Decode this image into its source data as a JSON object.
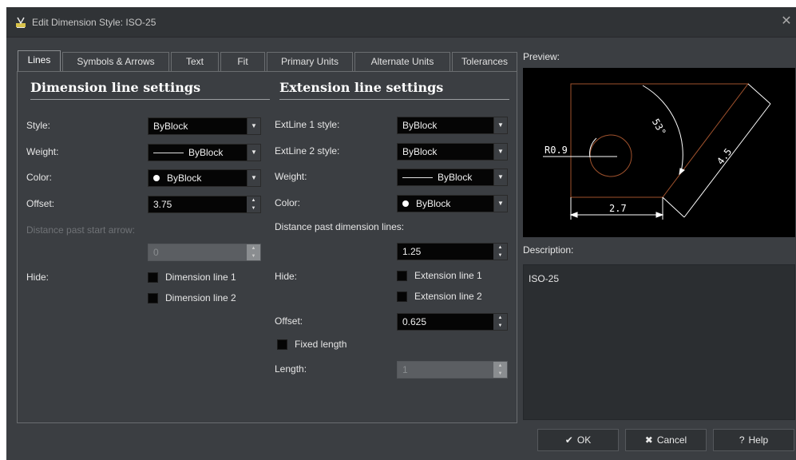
{
  "window": {
    "title": "Edit Dimension Style: ISO-25",
    "close_glyph": "✕",
    "icon": "dimension-style-icon"
  },
  "tabs": [
    {
      "label": "Lines",
      "active": true
    },
    {
      "label": "Symbols & Arrows"
    },
    {
      "label": "Text"
    },
    {
      "label": "Fit"
    },
    {
      "label": "Primary Units"
    },
    {
      "label": "Alternate Units"
    },
    {
      "label": "Tolerances"
    }
  ],
  "dimension_line": {
    "heading": "Dimension line settings",
    "style": {
      "label": "Style:",
      "value": "ByBlock"
    },
    "weight": {
      "label": "Weight:",
      "value": "ByBlock"
    },
    "color": {
      "label": "Color:",
      "value": "ByBlock"
    },
    "offset": {
      "label": "Offset:",
      "value": "3.75"
    },
    "distance_past_start": {
      "label": "Distance past start arrow:",
      "value": "0"
    },
    "hide": {
      "label": "Hide:",
      "line1": "Dimension line 1",
      "line2": "Dimension line 2"
    }
  },
  "extension_line": {
    "heading": "Extension line settings",
    "extline1_style": {
      "label": "ExtLine 1 style:",
      "value": "ByBlock"
    },
    "extline2_style": {
      "label": "ExtLine 2 style:",
      "value": "ByBlock"
    },
    "weight": {
      "label": "Weight:",
      "value": "ByBlock"
    },
    "color": {
      "label": "Color:",
      "value": "ByBlock"
    },
    "distance_past_dim": {
      "label": "Distance past dimension lines:",
      "value": "1.25"
    },
    "hide": {
      "label": "Hide:",
      "line1": "Extension line 1",
      "line2": "Extension line 2"
    },
    "offset": {
      "label": "Offset:",
      "value": "0.625"
    },
    "fixed_length": {
      "label": "Fixed length"
    },
    "length": {
      "label": "Length:",
      "value": "1"
    }
  },
  "preview": {
    "label": "Preview:",
    "radius_text": "R0.9",
    "angle_text": "53°",
    "aligned_text": "4.5",
    "linear_text": "2.7"
  },
  "description": {
    "label": "Description:",
    "text": "ISO-25"
  },
  "buttons": {
    "ok": "OK",
    "cancel": "Cancel",
    "help": "Help",
    "ok_icon": "checkmark-icon",
    "cancel_icon": "x-icon",
    "help_icon": "question-icon"
  },
  "colors": {
    "dialog_bg": "#3b3e42",
    "field_bg": "#050505",
    "preview_bg": "#000000",
    "preview_geometry": "#a0522d",
    "preview_dimension": "#ffffff"
  }
}
